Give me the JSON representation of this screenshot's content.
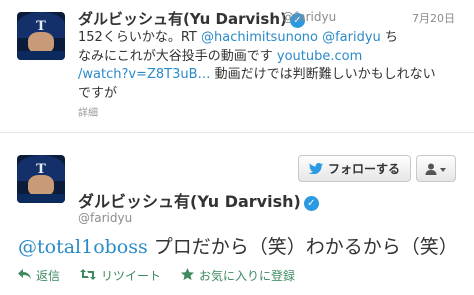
{
  "tweet1": {
    "name": "ダルビッシュ有(Yu Darvish)",
    "handle": "@faridyu",
    "date": "7月20日",
    "avatar_logo": "T",
    "line1_pre": "152くらいかな。RT ",
    "mention1": "@hachimitsunono",
    "mention2": "@faridyu",
    "line1_post": " ち",
    "line2_pre": "なみにこれが大谷投手の動画です ",
    "link1": "youtube.com",
    "link2": "/watch?v=Z8T3uB…",
    "line3_post": " 動画だけでは判断難しいかもしれない",
    "line4": "ですが",
    "detail": "詳細"
  },
  "tweet2": {
    "name": "ダルビッシュ有(Yu Darvish)",
    "handle": "@faridyu",
    "avatar_logo": "T",
    "follow_label": "フォローする",
    "mention": "@total1oboss",
    "text": " プロだから（笑）わかるから（笑）",
    "actions": {
      "reply": "返信",
      "retweet": "リツイート",
      "favorite": "お気に入りに登録"
    }
  },
  "colors": {
    "link": "#2b8ac8",
    "verified": "#2b9ae0",
    "action": "#3d8a5f"
  }
}
